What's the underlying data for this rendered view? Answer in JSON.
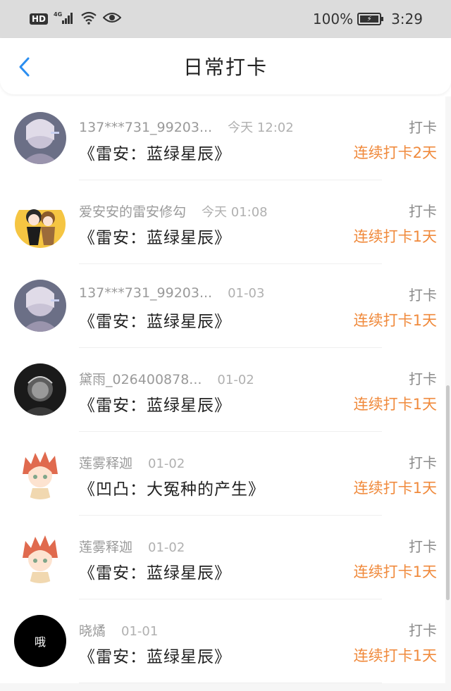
{
  "status_bar": {
    "hd": "HD",
    "network": "4G",
    "battery_percent": "100%",
    "time": "3:29",
    "icons": [
      "hd-badge",
      "signal-icon",
      "wifi-icon",
      "eye-icon",
      "battery-icon"
    ]
  },
  "header": {
    "title": "日常打卡",
    "back_icon": "chevron-left-icon",
    "accent": "#2b8ef0"
  },
  "colors": {
    "streak": "#f08a3c",
    "list_bg": "#f6f6f6"
  },
  "checkins": [
    {
      "name": "137***731_99203...",
      "time": "今天 12:02",
      "book": "《雷安：蓝绿星辰》",
      "label": "打卡",
      "streak": "连续打卡2天",
      "avatar": "avatar-gray-anime"
    },
    {
      "name": "爱安安的雷安修勾",
      "time": "今天 01:08",
      "book": "《雷安：蓝绿星辰》",
      "label": "打卡",
      "streak": "连续打卡1天",
      "avatar": "avatar-chibi-duo"
    },
    {
      "name": "137***731_99203...",
      "time": "01-03",
      "book": "《雷安：蓝绿星辰》",
      "label": "打卡",
      "streak": "连续打卡1天",
      "avatar": "avatar-gray-anime"
    },
    {
      "name": "黛雨_026400878...",
      "time": "01-02",
      "book": "《雷安：蓝绿星辰》",
      "label": "打卡",
      "streak": "连续打卡1天",
      "avatar": "avatar-dark"
    },
    {
      "name": "莲雾释迦",
      "time": "01-02",
      "book": "《凹凸：大冤种的产生》",
      "label": "打卡",
      "streak": "连续打卡1天",
      "avatar": "avatar-red-hair"
    },
    {
      "name": "莲雾释迦",
      "time": "01-02",
      "book": "《雷安：蓝绿星辰》",
      "label": "打卡",
      "streak": "连续打卡1天",
      "avatar": "avatar-red-hair"
    },
    {
      "name": "晓燏",
      "time": "01-01",
      "book": "《雷安：蓝绿星辰》",
      "label": "打卡",
      "streak": "连续打卡1天",
      "avatar": "avatar-black-text",
      "avatar_text": "哦"
    }
  ]
}
